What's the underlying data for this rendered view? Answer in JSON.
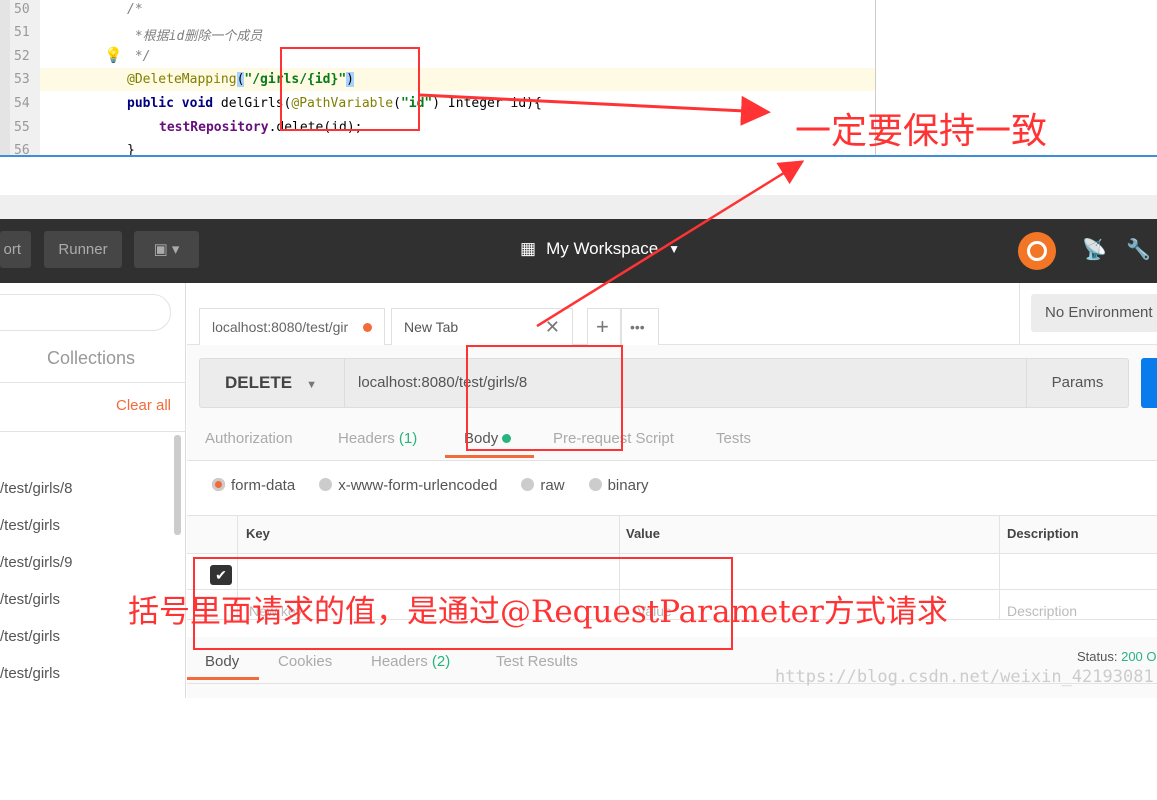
{
  "ide": {
    "lines": [
      {
        "num": "50",
        "text": "/*"
      },
      {
        "num": "51",
        "text": " *根据id删除一个成员"
      },
      {
        "num": "52",
        "text": " */"
      },
      {
        "num": "53",
        "annotation": "@DeleteMapping",
        "paren_open": "(",
        "string": "\"/girls/{id}\"",
        "paren_close": ")"
      },
      {
        "num": "54",
        "kw": "public void",
        "method": " delGirls(",
        "annotation": "@PathVariable",
        "paren_open": "(",
        "string": "\"id\"",
        "rest": ") Integer id){"
      },
      {
        "num": "55",
        "field": "testRepository",
        "rest": ".delete(id);"
      },
      {
        "num": "56",
        "text": "}"
      }
    ]
  },
  "postman": {
    "toolbar": {
      "import_label": "ort",
      "runner_label": "Runner",
      "new_icon": "new-window-icon",
      "workspace_label": "My Workspace"
    },
    "sidebar": {
      "collections_tab": "Collections",
      "clear_all": "Clear all",
      "history": [
        "/test/girls/8",
        "/test/girls",
        "/test/girls/9",
        "/test/girls",
        "/test/girls",
        "/test/girls"
      ]
    },
    "tabs": [
      {
        "label": "localhost:8080/test/gir",
        "dot_color": "#f26b3a"
      },
      {
        "label": "New Tab"
      }
    ],
    "environment": "No Environment",
    "request": {
      "method": "DELETE",
      "url": "localhost:8080/test/girls/8",
      "params_label": "Params"
    },
    "request_tabs": {
      "authorization": "Authorization",
      "headers": "Headers",
      "headers_count": "(1)",
      "body": "Body",
      "prerequest": "Pre-request Script",
      "tests": "Tests"
    },
    "body_modes": [
      "form-data",
      "x-www-form-urlencoded",
      "raw",
      "binary"
    ],
    "table": {
      "headers": [
        "Key",
        "Value",
        "Description"
      ],
      "placeholders": [
        "New key",
        "Value",
        "Description"
      ]
    },
    "response_tabs": {
      "body": "Body",
      "cookies": "Cookies",
      "headers": "Headers",
      "headers_count": "(2)",
      "test_results": "Test Results"
    },
    "status_label": "Status:",
    "status_value": "200 O"
  },
  "annotations": {
    "note1": "一定要保持一致",
    "note2": "括号里面请求的值，是通过@RequestParameter方式请求",
    "color": "#ff3333"
  },
  "watermark": "https://blog.csdn.net/weixin_42193081"
}
